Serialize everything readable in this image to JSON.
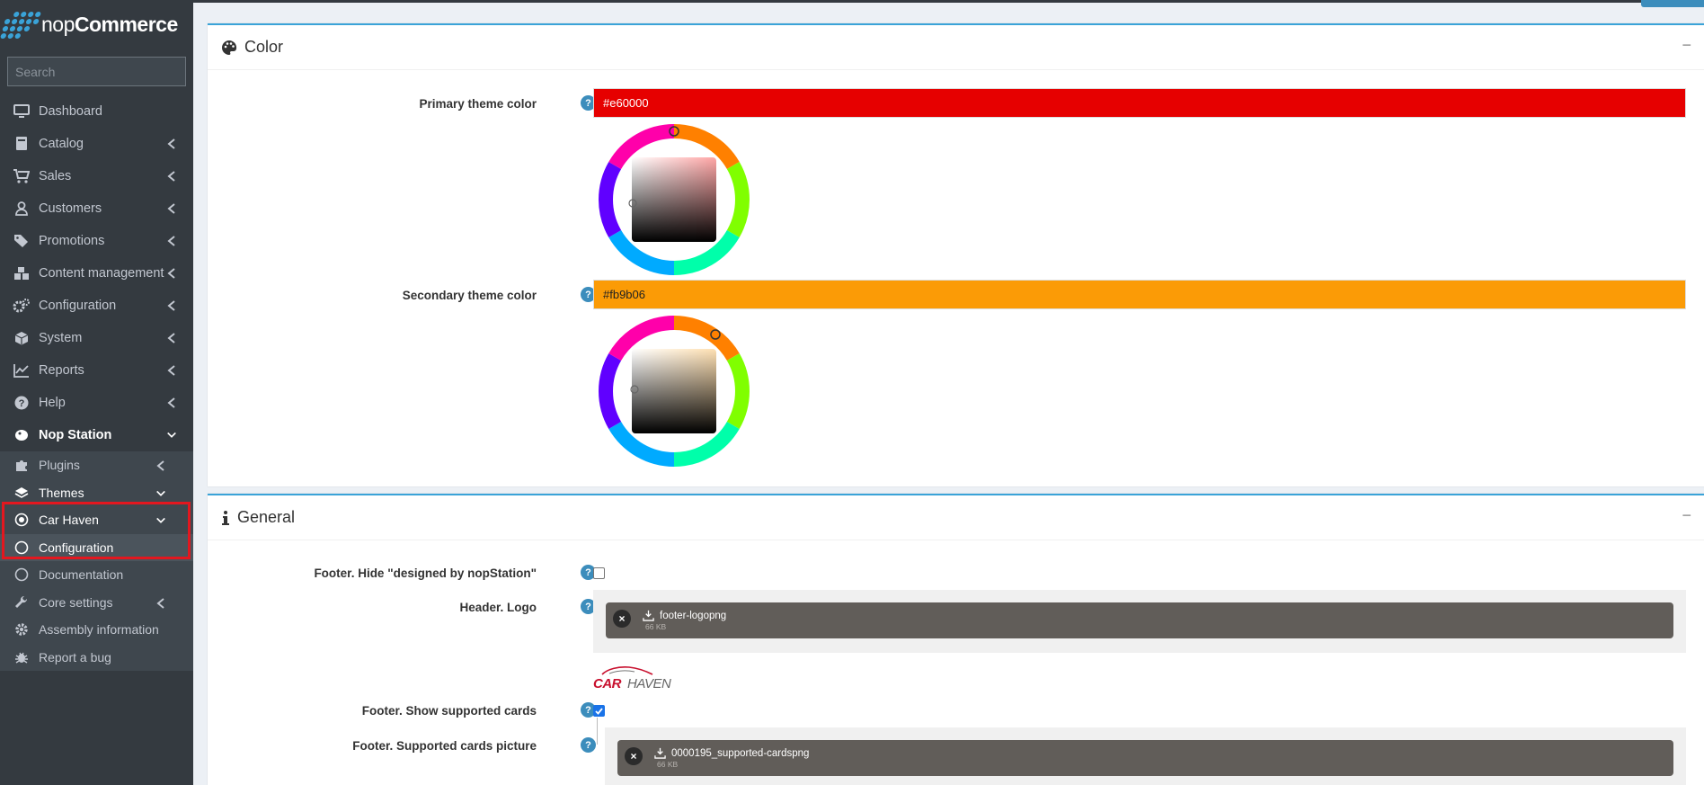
{
  "brand": {
    "name_light": "nop",
    "name_bold": "Commerce"
  },
  "search": {
    "placeholder": "Search"
  },
  "sidebar": {
    "items": [
      {
        "label": "Dashboard",
        "icon": "desktop-icon"
      },
      {
        "label": "Catalog",
        "icon": "book-icon"
      },
      {
        "label": "Sales",
        "icon": "cart-icon"
      },
      {
        "label": "Customers",
        "icon": "user-icon"
      },
      {
        "label": "Promotions",
        "icon": "tags-icon"
      },
      {
        "label": "Content management",
        "icon": "cubes-icon"
      },
      {
        "label": "Configuration",
        "icon": "gears-icon"
      },
      {
        "label": "System",
        "icon": "cube-icon"
      },
      {
        "label": "Reports",
        "icon": "line-chart-icon"
      },
      {
        "label": "Help",
        "icon": "question-circle-icon"
      },
      {
        "label": "Nop Station",
        "icon": "nopstation-icon"
      }
    ],
    "sub_items": [
      {
        "label": "Plugins",
        "icon": "puzzle-icon"
      },
      {
        "label": "Themes",
        "icon": "layers-icon"
      },
      {
        "label": "Car Haven",
        "icon": "dot-circle-icon"
      },
      {
        "label": "Configuration",
        "icon": "circle-icon"
      },
      {
        "label": "Documentation",
        "icon": "circle-icon"
      },
      {
        "label": "Core settings",
        "icon": "wrench-icon"
      },
      {
        "label": "Assembly information",
        "icon": "gear-icon"
      },
      {
        "label": "Report a bug",
        "icon": "bug-icon"
      }
    ]
  },
  "color_card": {
    "title": "Color",
    "collapse": "−",
    "primary": {
      "label": "Primary theme color",
      "value": "#e60000",
      "display_color": "#e60000"
    },
    "secondary": {
      "label": "Secondary theme color",
      "value": "#fb9b06",
      "display_color": "#fb9b06"
    }
  },
  "general_card": {
    "title": "General",
    "collapse": "−",
    "footer_hide": {
      "label": "Footer. Hide \"designed by nopStation\"",
      "checked": false
    },
    "header_logo": {
      "label": "Header. Logo",
      "file_name": "footer-logopng",
      "file_size": "66 KB"
    },
    "logo": {
      "text_red": "CAR",
      "text_gray": "HAVEN"
    },
    "footer_show_cards": {
      "label": "Footer. Show supported cards",
      "checked": true
    },
    "supported_cards": {
      "label": "Footer. Supported cards picture",
      "file_name": "0000195_supported-cardspng",
      "file_size": "66 KB"
    }
  },
  "help_glyph": "?",
  "remove_glyph": "×"
}
